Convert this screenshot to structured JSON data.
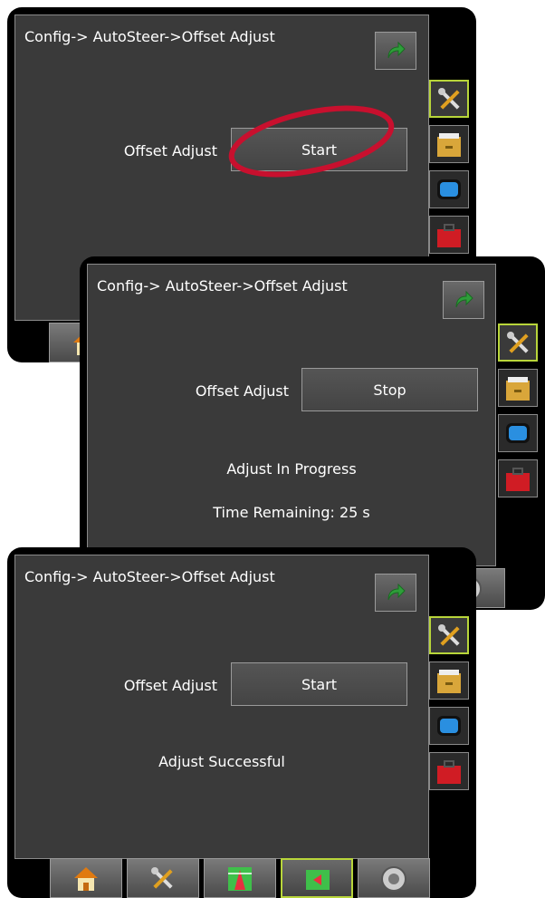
{
  "panel1": {
    "breadcrumb": "Config-> AutoSteer->Offset Adjust",
    "offset_label": "Offset Adjust",
    "button_label": "Start"
  },
  "panel2": {
    "breadcrumb": "Config-> AutoSteer->Offset Adjust",
    "offset_label": "Offset Adjust",
    "button_label": "Stop",
    "status": "Adjust In Progress",
    "time_remaining": "Time Remaining: 25 s"
  },
  "panel3": {
    "breadcrumb": "Config-> AutoSteer->Offset Adjust",
    "offset_label": "Offset Adjust",
    "button_label": "Start",
    "status": "Adjust Successful"
  },
  "sidebar": {
    "items": [
      {
        "icon": "tools-icon",
        "active": true
      },
      {
        "icon": "file-cabinet-icon",
        "active": false
      },
      {
        "icon": "display-icon",
        "active": false
      },
      {
        "icon": "toolbox-icon",
        "active": false
      }
    ]
  },
  "bottom_bar": {
    "tabs": [
      {
        "icon": "home-icon",
        "active": false
      },
      {
        "icon": "tools-icon",
        "active": false
      },
      {
        "icon": "guidance-field-icon",
        "active": false
      },
      {
        "icon": "map-pointer-icon",
        "active": true
      },
      {
        "icon": "gauge-icon",
        "active": false
      }
    ]
  },
  "colors": {
    "background": "#3a3a3a",
    "active_border": "#b8d53a",
    "highlight": "#c8102e",
    "back_arrow": "#2e9e3a"
  }
}
